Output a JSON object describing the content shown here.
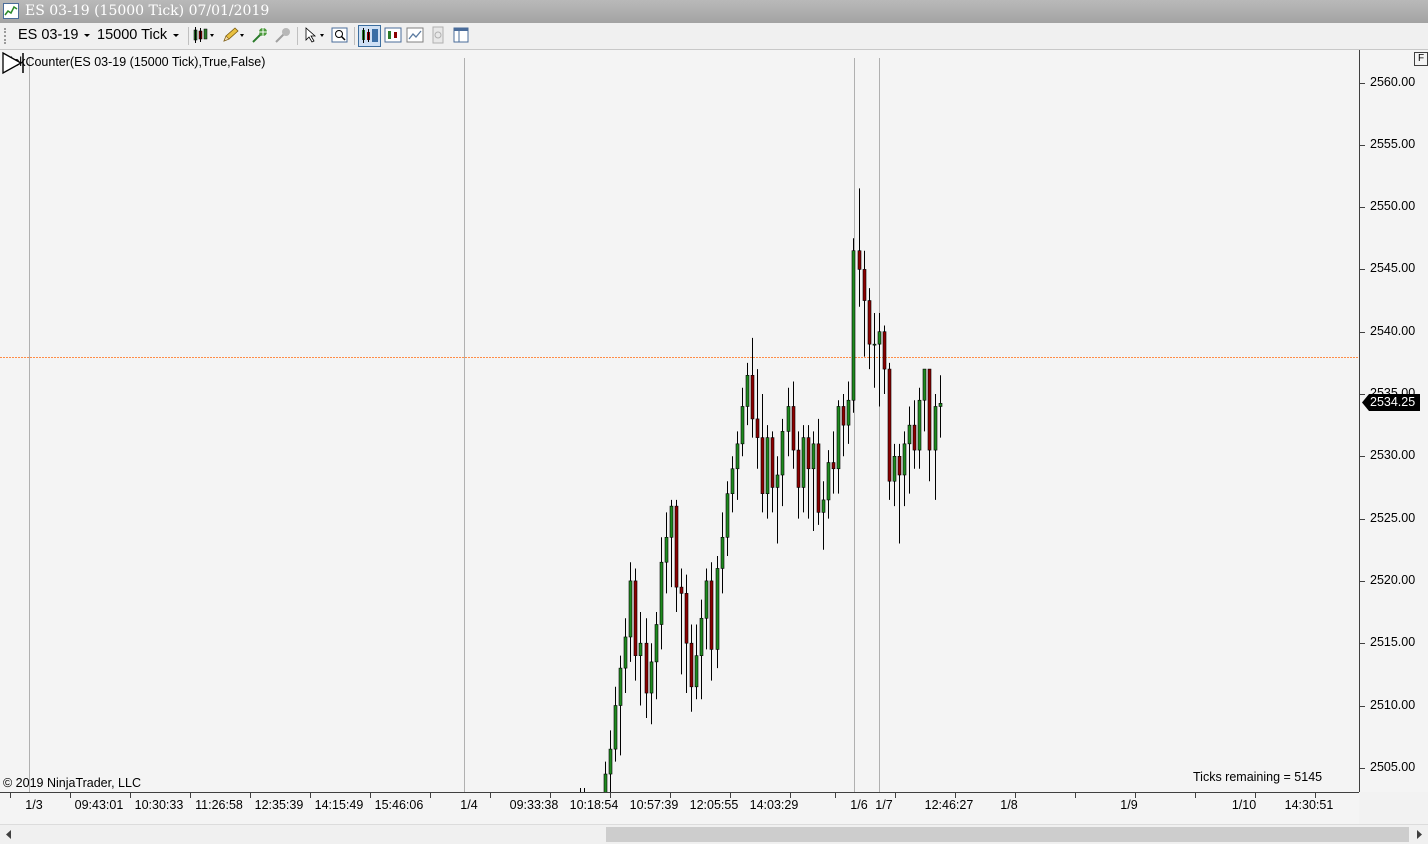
{
  "window": {
    "title": "ES 03-19 (15000 Tick)  07/01/2019"
  },
  "toolbar": {
    "instrument": "ES 03-19",
    "interval": "15000 Tick",
    "buttons": [
      "bar-style-icon",
      "drawing-tool-icon",
      "indicator-icon",
      "strategy-icon",
      "pointer-icon",
      "zoom-icon",
      "chart-trader-icon",
      "data-box-icon",
      "chart-style-icon",
      "properties-icon",
      "layout-icon"
    ]
  },
  "chart": {
    "indicator_label": "TickCounter(ES  03-19 (15000  Tick),True,False)",
    "copyright": "© 2019 NinjaTrader, LLC",
    "ticks_remaining": "Ticks remaining = 5145",
    "current_price": "2534.25",
    "price_line": 2538.0,
    "corner_button": "F",
    "colors": {
      "up": "#1e8a1e",
      "down": "#8b0000",
      "wick": "#000000",
      "price_line": "#ff8c46",
      "tag": "#000000"
    }
  },
  "y_axis": {
    "labels": [
      "2560.00",
      "2555.00",
      "2550.00",
      "2545.00",
      "2540.00",
      "2535.00",
      "2530.00",
      "2525.00",
      "2520.00",
      "2515.00",
      "2510.00",
      "2505.00"
    ]
  },
  "x_axis": {
    "labels": [
      "1/3",
      "09:43:01",
      "10:30:33",
      "11:26:58",
      "12:35:39",
      "14:15:49",
      "15:46:06",
      "1/4",
      "09:33:38",
      "10:18:54",
      "10:57:39",
      "12:05:55",
      "14:03:29",
      "1/6",
      "1/7",
      "12:46:27",
      "1/8",
      "1/9",
      "1/10",
      "14:30:51"
    ]
  },
  "chart_data": {
    "type": "candlestick",
    "title": "ES 03-19 (15000 Tick)",
    "ylim": [
      2502.5,
      2561.5
    ],
    "candles": [
      {
        "o": 2502.0,
        "h": 2505.5,
        "l": 2500.0,
        "c": 2504.5
      },
      {
        "o": 2504.5,
        "h": 2508.0,
        "l": 2503.0,
        "c": 2506.5
      },
      {
        "o": 2506.5,
        "h": 2511.5,
        "l": 2505.5,
        "c": 2510.0
      },
      {
        "o": 2510.0,
        "h": 2514.0,
        "l": 2506.0,
        "c": 2513.0
      },
      {
        "o": 2513.0,
        "h": 2517.0,
        "l": 2511.0,
        "c": 2515.5
      },
      {
        "o": 2515.5,
        "h": 2521.5,
        "l": 2513.5,
        "c": 2520.0
      },
      {
        "o": 2520.0,
        "h": 2521.0,
        "l": 2512.0,
        "c": 2514.0
      },
      {
        "o": 2514.0,
        "h": 2517.5,
        "l": 2510.0,
        "c": 2515.0
      },
      {
        "o": 2515.0,
        "h": 2517.0,
        "l": 2509.0,
        "c": 2511.0
      },
      {
        "o": 2511.0,
        "h": 2515.0,
        "l": 2508.5,
        "c": 2513.5
      },
      {
        "o": 2513.5,
        "h": 2517.5,
        "l": 2510.5,
        "c": 2516.5
      },
      {
        "o": 2516.5,
        "h": 2523.5,
        "l": 2514.5,
        "c": 2521.5
      },
      {
        "o": 2521.5,
        "h": 2525.5,
        "l": 2519.0,
        "c": 2523.5
      },
      {
        "o": 2523.5,
        "h": 2526.5,
        "l": 2519.5,
        "c": 2526.0
      },
      {
        "o": 2526.0,
        "h": 2526.5,
        "l": 2517.5,
        "c": 2519.5
      },
      {
        "o": 2519.5,
        "h": 2521.0,
        "l": 2512.5,
        "c": 2519.0
      },
      {
        "o": 2519.0,
        "h": 2520.5,
        "l": 2511.0,
        "c": 2515.0
      },
      {
        "o": 2515.0,
        "h": 2516.5,
        "l": 2509.5,
        "c": 2511.5
      },
      {
        "o": 2511.5,
        "h": 2516.5,
        "l": 2510.5,
        "c": 2514.0
      },
      {
        "o": 2514.0,
        "h": 2518.5,
        "l": 2510.5,
        "c": 2517.0
      },
      {
        "o": 2517.0,
        "h": 2521.0,
        "l": 2514.5,
        "c": 2520.0
      },
      {
        "o": 2520.0,
        "h": 2521.5,
        "l": 2512.0,
        "c": 2514.5
      },
      {
        "o": 2514.5,
        "h": 2522.0,
        "l": 2513.0,
        "c": 2521.0
      },
      {
        "o": 2521.0,
        "h": 2525.5,
        "l": 2519.0,
        "c": 2523.5
      },
      {
        "o": 2523.5,
        "h": 2528.0,
        "l": 2522.0,
        "c": 2527.0
      },
      {
        "o": 2527.0,
        "h": 2530.0,
        "l": 2525.5,
        "c": 2529.0
      },
      {
        "o": 2529.0,
        "h": 2532.0,
        "l": 2526.5,
        "c": 2531.0
      },
      {
        "o": 2531.0,
        "h": 2535.5,
        "l": 2530.0,
        "c": 2534.0
      },
      {
        "o": 2534.0,
        "h": 2537.5,
        "l": 2532.5,
        "c": 2536.5
      },
      {
        "o": 2536.5,
        "h": 2539.5,
        "l": 2531.5,
        "c": 2533.0
      },
      {
        "o": 2533.0,
        "h": 2537.0,
        "l": 2529.0,
        "c": 2531.5
      },
      {
        "o": 2531.5,
        "h": 2535.0,
        "l": 2525.5,
        "c": 2527.0
      },
      {
        "o": 2527.0,
        "h": 2532.5,
        "l": 2525.0,
        "c": 2531.5
      },
      {
        "o": 2531.5,
        "h": 2532.0,
        "l": 2525.5,
        "c": 2527.5
      },
      {
        "o": 2527.5,
        "h": 2530.0,
        "l": 2523.0,
        "c": 2528.5
      },
      {
        "o": 2528.5,
        "h": 2533.0,
        "l": 2526.0,
        "c": 2532.0
      },
      {
        "o": 2532.0,
        "h": 2535.5,
        "l": 2530.0,
        "c": 2534.0
      },
      {
        "o": 2534.0,
        "h": 2536.0,
        "l": 2529.0,
        "c": 2530.5
      },
      {
        "o": 2530.5,
        "h": 2532.0,
        "l": 2525.0,
        "c": 2527.5
      },
      {
        "o": 2527.5,
        "h": 2532.5,
        "l": 2525.5,
        "c": 2531.5
      },
      {
        "o": 2531.5,
        "h": 2532.5,
        "l": 2525.0,
        "c": 2529.0
      },
      {
        "o": 2529.0,
        "h": 2532.0,
        "l": 2524.0,
        "c": 2531.0
      },
      {
        "o": 2531.0,
        "h": 2533.0,
        "l": 2524.5,
        "c": 2525.5
      },
      {
        "o": 2525.5,
        "h": 2528.0,
        "l": 2522.5,
        "c": 2526.5
      },
      {
        "o": 2526.5,
        "h": 2530.5,
        "l": 2525.0,
        "c": 2529.5
      },
      {
        "o": 2529.5,
        "h": 2532.0,
        "l": 2527.0,
        "c": 2529.0
      },
      {
        "o": 2529.0,
        "h": 2534.5,
        "l": 2527.0,
        "c": 2534.0
      },
      {
        "o": 2534.0,
        "h": 2535.0,
        "l": 2530.0,
        "c": 2532.5
      },
      {
        "o": 2532.5,
        "h": 2536.0,
        "l": 2531.0,
        "c": 2534.5
      },
      {
        "o": 2534.5,
        "h": 2547.5,
        "l": 2533.5,
        "c": 2546.5
      },
      {
        "o": 2546.5,
        "h": 2551.5,
        "l": 2542.0,
        "c": 2545.0
      },
      {
        "o": 2545.0,
        "h": 2546.5,
        "l": 2538.0,
        "c": 2542.5
      },
      {
        "o": 2542.5,
        "h": 2543.5,
        "l": 2537.0,
        "c": 2539.0
      },
      {
        "o": 2539.0,
        "h": 2541.5,
        "l": 2535.5,
        "c": 2539.0
      },
      {
        "o": 2539.0,
        "h": 2541.5,
        "l": 2534.0,
        "c": 2540.0
      },
      {
        "o": 2540.0,
        "h": 2540.5,
        "l": 2535.0,
        "c": 2537.0
      },
      {
        "o": 2537.0,
        "h": 2537.5,
        "l": 2526.5,
        "c": 2528.0
      },
      {
        "o": 2528.0,
        "h": 2531.0,
        "l": 2526.0,
        "c": 2530.0
      },
      {
        "o": 2530.0,
        "h": 2531.0,
        "l": 2523.0,
        "c": 2528.5
      },
      {
        "o": 2528.5,
        "h": 2532.0,
        "l": 2526.0,
        "c": 2531.0
      },
      {
        "o": 2531.0,
        "h": 2534.0,
        "l": 2527.0,
        "c": 2532.5
      },
      {
        "o": 2532.5,
        "h": 2534.5,
        "l": 2529.0,
        "c": 2530.5
      },
      {
        "o": 2530.5,
        "h": 2535.5,
        "l": 2529.0,
        "c": 2534.5
      },
      {
        "o": 2534.5,
        "h": 2537.0,
        "l": 2532.0,
        "c": 2537.0
      },
      {
        "o": 2537.0,
        "h": 2537.0,
        "l": 2528.0,
        "c": 2530.5
      },
      {
        "o": 2530.5,
        "h": 2535.0,
        "l": 2526.5,
        "c": 2534.0
      },
      {
        "o": 2534.0,
        "h": 2536.5,
        "l": 2531.5,
        "c": 2534.25
      }
    ]
  }
}
